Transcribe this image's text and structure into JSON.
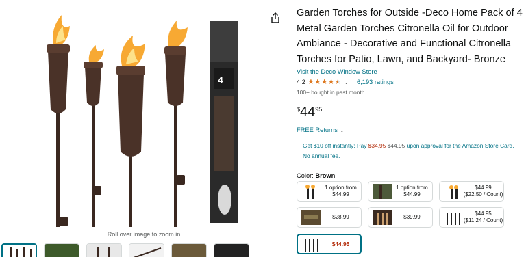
{
  "share": {
    "icon": "share-icon"
  },
  "gallery": {
    "zoom_hint": "Roll over image to zoom in",
    "box_label": "4"
  },
  "product": {
    "title": "Garden Torches for Outside -Deco Home Pack of 4 Metal Garden Torches Citronella Oil for Outdoor Ambiance - Decorative and Functional Citronella Torches for Patio, Lawn, and Backyard- Bronze",
    "store_link": "Visit the Deco Window Store",
    "rating": "4.2",
    "ratings_count": "6,193 ratings",
    "bought": "100+ bought in past month",
    "price": {
      "symbol": "$",
      "whole": "44",
      "fraction": "95"
    },
    "free_returns": "FREE Returns",
    "promo": {
      "prefix": "Get $10 off instantly: Pay ",
      "sale_price": "$34.95",
      "original_price": "$44.95",
      "suffix": " upon approval for the Amazon Store Card. No annual fee."
    },
    "color_label": "Color: ",
    "color_value": "Brown"
  },
  "options": [
    {
      "line1": "1 option from",
      "line2": "$44.99"
    },
    {
      "line1": "1 option from",
      "line2": "$44.99"
    },
    {
      "line1": "$44.99",
      "line2": "($22.50 / Count)"
    },
    {
      "line1": "$28.99",
      "line2": ""
    },
    {
      "line1": "$39.99",
      "line2": ""
    },
    {
      "line1": "$44.95",
      "line2": "($11.24 / Count)"
    },
    {
      "line1": "$44.95",
      "line2": ""
    }
  ],
  "colors": {
    "link": "#007185",
    "star": "#de7921",
    "price_red": "#b12704",
    "bronze": "#4a3228"
  }
}
